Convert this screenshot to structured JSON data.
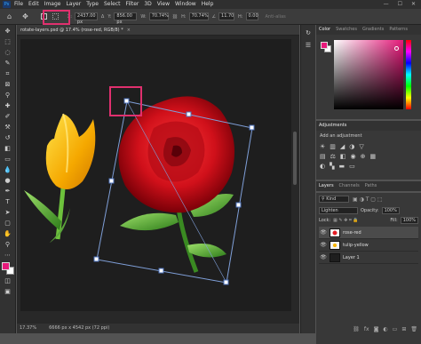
{
  "app": {
    "logo": "Ps"
  },
  "menu": [
    "File",
    "Edit",
    "Image",
    "Layer",
    "Type",
    "Select",
    "Filter",
    "3D",
    "View",
    "Window",
    "Help"
  ],
  "window_controls": {
    "minimize": "—",
    "maximize": "☐",
    "close": "✕"
  },
  "options": {
    "x_value": "2437.00 px",
    "y_value": "856.00 px",
    "w_value": "70.74%",
    "h_value": "70.74%",
    "angle_value": "11.70",
    "h_skew": "0.00",
    "w_label": "W:",
    "h_label": "H:",
    "anti_alias": "Anti-alias"
  },
  "document": {
    "tab_title": "rotate-layers.psd @ 17.4% (rose-red, RGB/8) *",
    "zoom": "17.37%",
    "doc_info": "6666 px x 4542 px (72 ppi)"
  },
  "panels": {
    "color_tabs": [
      "Color",
      "Swatches",
      "Gradients",
      "Patterns"
    ],
    "adjustments_title": "Adjustments",
    "add_adjustment": "Add an adjustment",
    "layers_tabs": [
      "Layers",
      "Channels",
      "Paths"
    ],
    "kind_label": "Kind",
    "blend_mode": "Lighten",
    "opacity_label": "Opacity:",
    "opacity_value": "100%",
    "lock_label": "Lock:",
    "fill_label": "Fill:",
    "fill_value": "100%",
    "layers": [
      {
        "name": "rose-red",
        "selected": true
      },
      {
        "name": "tulip-yellow",
        "selected": false
      },
      {
        "name": "Layer 1",
        "selected": false
      }
    ]
  },
  "colors": {
    "foreground": "#e6197a",
    "background": "#ffffff",
    "highlight": "#e0306e",
    "accent": "#31a8ff"
  }
}
